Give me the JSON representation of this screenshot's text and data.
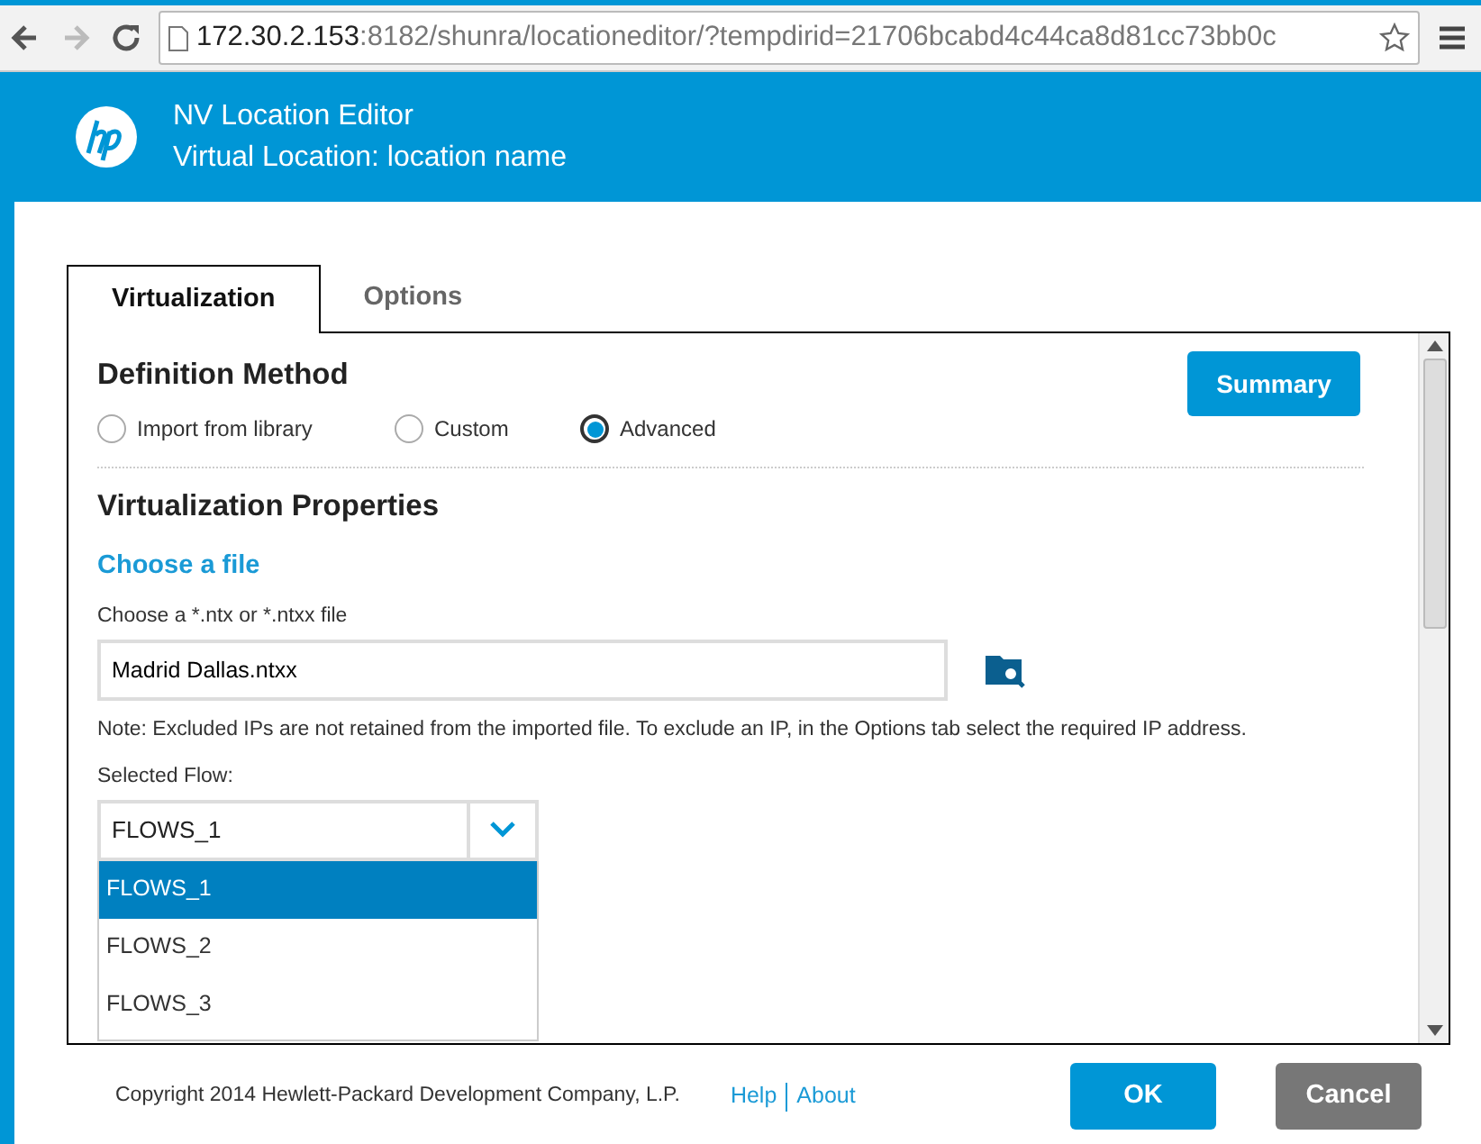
{
  "browser": {
    "url_host": "172.30.2.153",
    "url_rest": ":8182/shunra/locationeditor/?tempdirid=21706bcabd4c44ca8d81cc73bb0c"
  },
  "header": {
    "title": "NV Location Editor",
    "subtitle": "Virtual Location: location name"
  },
  "tabs": [
    {
      "label": "Virtualization",
      "selected": true
    },
    {
      "label": "Options",
      "selected": false
    }
  ],
  "definition": {
    "heading": "Definition Method",
    "summary_button": "Summary",
    "options": [
      {
        "label": "Import from library",
        "selected": false
      },
      {
        "label": "Custom",
        "selected": false
      },
      {
        "label": "Advanced",
        "selected": true
      }
    ]
  },
  "properties": {
    "heading": "Virtualization Properties",
    "link": "Choose a file",
    "file_label": "Choose a *.ntx or *.ntxx file",
    "file_value": "Madrid Dallas.ntxx",
    "note": "Note: Excluded IPs are not retained from the imported file. To exclude an IP, in the Options tab select the required IP address.",
    "flow_label": "Selected Flow:",
    "flow_value": "FLOWS_1",
    "flow_options": [
      {
        "label": "FLOWS_1",
        "selected": true
      },
      {
        "label": "FLOWS_2",
        "selected": false
      },
      {
        "label": "FLOWS_3",
        "selected": false
      }
    ]
  },
  "footer": {
    "copyright": "Copyright 2014 Hewlett-Packard Development Company, L.P.",
    "links": [
      "Help",
      "About"
    ],
    "buttons": [
      "OK",
      "Cancel"
    ]
  }
}
